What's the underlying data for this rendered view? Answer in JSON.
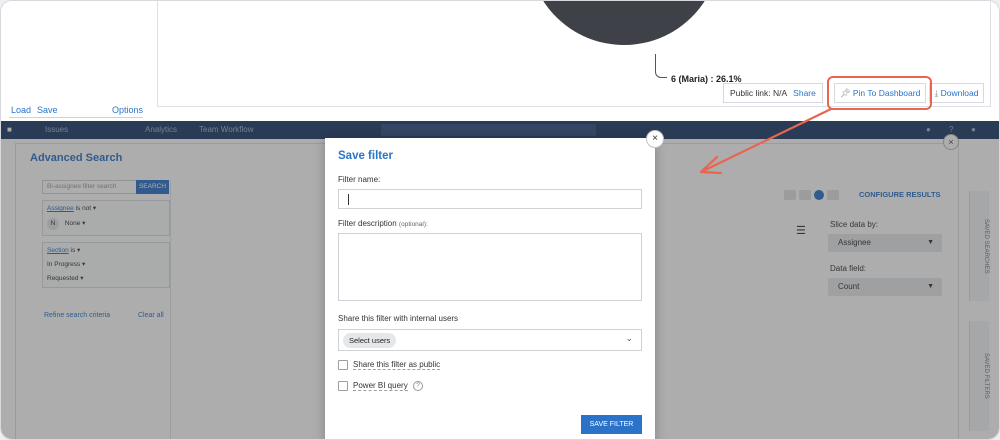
{
  "report": {
    "pie_label": "6 (Maria) : 26.1%",
    "public_link_label": "Public link: N/A",
    "share_label": "Share",
    "pin_label": "Pin To Dashboard",
    "download_label": "Download",
    "load_label": "Load",
    "save_label": "Save",
    "options_label": "Options",
    "colors": {
      "pie_dark": "#3e4147",
      "pie_green": "#7ee07a",
      "accent": "#2a73c9",
      "highlight": "#e8654f"
    }
  },
  "navbar": {
    "items": [
      "Issues",
      "Analytics",
      "Team Workflow"
    ]
  },
  "advanced_search": {
    "title": "Advanced Search",
    "search_placeholder": "Bi-assignee filter search",
    "search_button": "SEARCH",
    "filter1_field": "Assignee",
    "filter1_op": "is not ▾",
    "filter1_value": "None ▾",
    "filter1_avatar": "N",
    "filter2_field": "Section",
    "filter2_op": "is ▾",
    "filter2_value1": "In Progress ▾",
    "filter2_value2": "Requested ▾",
    "refine_label": "Refine search criteria",
    "clear_label": "Clear all",
    "configure_label": "CONFIGURE RESULTS",
    "slice_label": "Slice data by:",
    "slice_value": "Assignee",
    "datafield_label": "Data field:",
    "datafield_value": "Count",
    "side_tab_1": "SAVED SEARCHES",
    "side_tab_2": "SAVED FILTERS"
  },
  "modal": {
    "title": "Save filter",
    "name_label": "Filter name:",
    "name_value": "",
    "desc_label": "Filter description",
    "desc_optional": "(optional):",
    "desc_value": "",
    "share_label": "Share this filter with internal users",
    "select_users": "Select users",
    "public_label": "Share this filter as public",
    "powerbi_label": "Power BI query",
    "save_button": "SAVE FILTER",
    "close_symbol": "×",
    "help_symbol": "?"
  }
}
